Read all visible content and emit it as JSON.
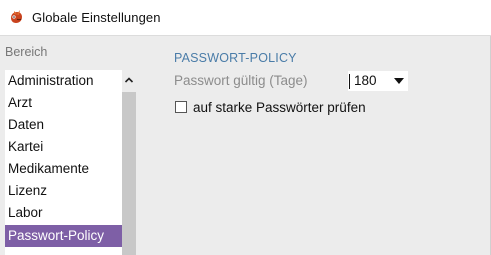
{
  "window": {
    "title": "Globale Einstellungen",
    "icon": "app-logo-icon"
  },
  "sidebar": {
    "label": "Bereich",
    "items": [
      {
        "label": "Administration"
      },
      {
        "label": "Arzt"
      },
      {
        "label": "Daten"
      },
      {
        "label": "Kartei"
      },
      {
        "label": "Medikamente"
      },
      {
        "label": "Lizenz"
      },
      {
        "label": "Labor"
      },
      {
        "label": "Passwort-Policy"
      }
    ],
    "selected_index": 7,
    "selected_color": "#7e5fa6"
  },
  "main": {
    "section_title": "PASSWORT-POLICY",
    "section_title_color": "#4a7ca8",
    "validity_label": "Passwort gültig (Tage)",
    "validity_value": "180",
    "strong_check_label": "auf starke Passwörter prüfen",
    "strong_check_checked": false
  }
}
